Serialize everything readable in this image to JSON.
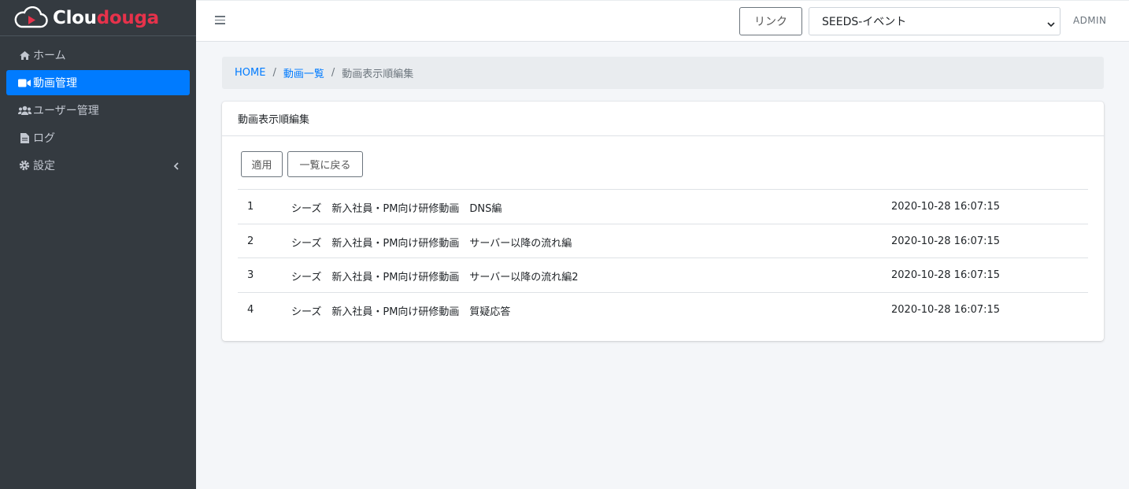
{
  "brand": {
    "name_part1": "Clou",
    "name_part2": "douga"
  },
  "sidebar": {
    "items": [
      {
        "label": "ホーム",
        "icon": "home-icon",
        "active": false
      },
      {
        "label": "動画管理",
        "icon": "video-camera-icon",
        "active": true
      },
      {
        "label": "ユーザー管理",
        "icon": "users-icon",
        "active": false
      },
      {
        "label": "ログ",
        "icon": "file-icon",
        "active": false
      },
      {
        "label": "設定",
        "icon": "gear-icon",
        "active": false,
        "has_arrow": true
      }
    ]
  },
  "topbar": {
    "link_label": "リンク",
    "event_selected": "SEEDS-イベント",
    "user_label": "ADMIN"
  },
  "breadcrumb": {
    "home": "HOME",
    "list": "動画一覧",
    "current": "動画表示順編集"
  },
  "card": {
    "title": "動画表示順編集",
    "apply_label": "適用",
    "back_label": "一覧に戻る",
    "rows": [
      {
        "num": "1",
        "title": "シーズ　新入社員・PM向け研修動画　DNS編",
        "date": "2020-10-28 16:07:15"
      },
      {
        "num": "2",
        "title": "シーズ　新入社員・PM向け研修動画　サーバー以降の流れ編",
        "date": "2020-10-28 16:07:15"
      },
      {
        "num": "3",
        "title": "シーズ　新入社員・PM向け研修動画　サーバー以降の流れ編2",
        "date": "2020-10-28 16:07:15"
      },
      {
        "num": "4",
        "title": "シーズ　新入社員・PM向け研修動画　質疑応答",
        "date": "2020-10-28 16:07:15"
      }
    ]
  },
  "colors": {
    "primary": "#007bff",
    "sidebar_bg": "#343a40",
    "brand_accent": "#e6324b"
  }
}
